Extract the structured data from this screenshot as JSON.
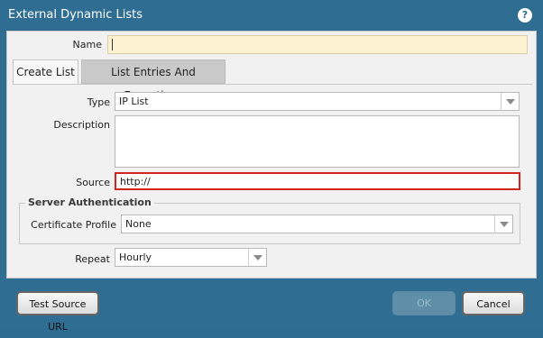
{
  "title": "External Dynamic Lists",
  "help_icon": "?",
  "name": {
    "label": "Name",
    "value": ""
  },
  "tabs": [
    {
      "label": "Create List",
      "active": true
    },
    {
      "label": "List Entries And Exceptions",
      "active": false
    }
  ],
  "type": {
    "label": "Type",
    "value": "IP List"
  },
  "description": {
    "label": "Description",
    "value": ""
  },
  "source": {
    "label": "Source",
    "value": "http://"
  },
  "server_auth": {
    "legend": "Server Authentication",
    "certificate_profile": {
      "label": "Certificate Profile",
      "value": "None"
    }
  },
  "repeat": {
    "label": "Repeat",
    "value": "Hourly"
  },
  "buttons": {
    "test_source_url": "Test Source URL",
    "ok": "OK",
    "cancel": "Cancel"
  }
}
